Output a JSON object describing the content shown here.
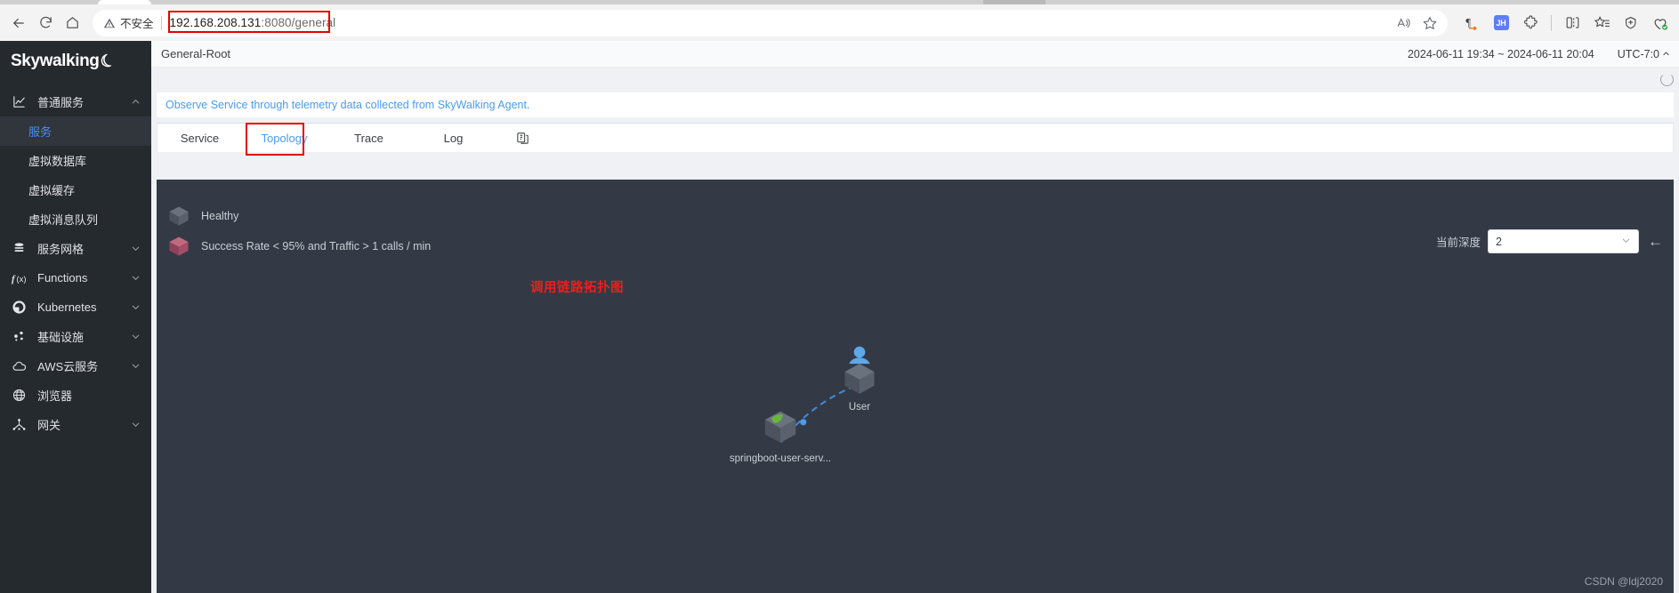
{
  "browser": {
    "nav": {
      "back": "back-arrow",
      "reload": "reload",
      "home": "home"
    },
    "omnibox": {
      "security_label": "不安全",
      "url_host": "192.168.208.131",
      "url_rest": ":8080/general",
      "read_aloud": "A",
      "favorite": "star"
    },
    "toolbar_icons": [
      {
        "name": "immersive-reader-icon",
        "glyph": "¶"
      },
      {
        "name": "jh-extension-icon",
        "glyph": "JH"
      },
      {
        "name": "extensions-icon",
        "glyph": "puzzle"
      },
      {
        "name": "split-screen-icon",
        "glyph": "split"
      },
      {
        "name": "collections-icon",
        "glyph": "star-list"
      },
      {
        "name": "add-tab-group-icon",
        "glyph": "shield-plus"
      },
      {
        "name": "browser-essentials-icon",
        "glyph": "heart-check"
      }
    ]
  },
  "sidebar": {
    "brand": "Skywalking",
    "items": [
      {
        "label": "普通服务",
        "icon": "chart-icon",
        "expandable": true,
        "expanded": true
      },
      {
        "label": "服务网格",
        "icon": "mesh-icon",
        "expandable": true,
        "expanded": false
      },
      {
        "label": "Functions",
        "icon": "function-icon",
        "expandable": true,
        "expanded": false
      },
      {
        "label": "Kubernetes",
        "icon": "kubernetes-icon",
        "expandable": true,
        "expanded": false
      },
      {
        "label": "基础设施",
        "icon": "infrastructure-icon",
        "expandable": true,
        "expanded": false
      },
      {
        "label": "AWS云服务",
        "icon": "cloud-icon",
        "expandable": true,
        "expanded": false
      },
      {
        "label": "浏览器",
        "icon": "globe-icon",
        "expandable": false,
        "expanded": false
      },
      {
        "label": "网关",
        "icon": "gateway-icon",
        "expandable": true,
        "expanded": false
      }
    ],
    "sub_items": [
      {
        "label": "服务",
        "active": true
      },
      {
        "label": "虚拟数据库",
        "active": false
      },
      {
        "label": "虚拟缓存",
        "active": false
      },
      {
        "label": "虚拟消息队列",
        "active": false
      }
    ]
  },
  "header": {
    "title": "General-Root",
    "time_range": "2024-06-11 19:34 ~ 2024-06-11 20:04",
    "timezone": "UTC-7:0"
  },
  "banner": {
    "text": "Observe Service through telemetry data collected from SkyWalking Agent."
  },
  "tabs": [
    {
      "label": "Service",
      "active": false,
      "highlight": false
    },
    {
      "label": "Topology",
      "active": true,
      "highlight": true
    },
    {
      "label": "Trace",
      "active": false,
      "highlight": false
    },
    {
      "label": "Log",
      "active": false,
      "highlight": false
    }
  ],
  "tabs_extra_icon": "copy-icon",
  "topology": {
    "legend": [
      {
        "label": "Healthy",
        "color": "#565e6b"
      },
      {
        "label": "Success Rate < 95% and Traffic > 1 calls / min",
        "color": "#a8516a"
      }
    ],
    "annotation": "调用链路拓扑图",
    "depth_label": "当前深度",
    "depth_value": "2",
    "back_icon": "arrow-left-icon",
    "nodes": [
      {
        "label": "springboot-user-serv...",
        "type": "service"
      },
      {
        "label": "User",
        "type": "user"
      }
    ]
  },
  "watermark": "CSDN @ldj2020",
  "colors": {
    "accent": "#4a9bf0",
    "annotation_red": "#ef1d1d",
    "sidebar_bg": "#252a2f",
    "topology_bg": "#343a45"
  }
}
